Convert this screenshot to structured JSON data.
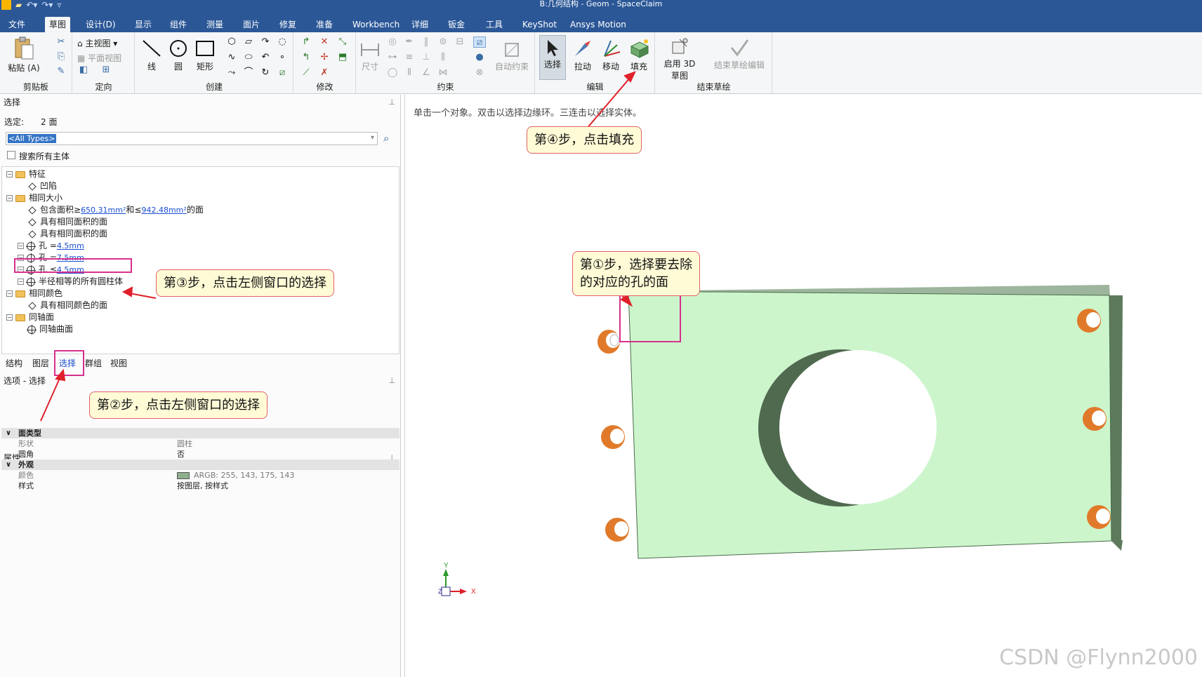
{
  "window": {
    "title": "B:几何结构 - Geom - SpaceClaim"
  },
  "menu_tabs": [
    "文件",
    "草图",
    "设计(D)",
    "显示",
    "组件",
    "测量",
    "面片",
    "修复",
    "准备",
    "Workbench",
    "详细",
    "钣金",
    "工具",
    "KeyShot",
    "Ansys Motion"
  ],
  "active_tab": "草图",
  "ribbon": {
    "clipboard": {
      "label": "剪贴板",
      "paste": "粘贴 (A)"
    },
    "orient": {
      "label": "定向",
      "main_view": "主视图",
      "plane_view": "平面视图"
    },
    "create": {
      "label": "创建",
      "line": "线",
      "circle": "圆",
      "rect": "矩形"
    },
    "modify": {
      "label": "修改"
    },
    "constraint": {
      "label": "约束",
      "dimension": "尺寸",
      "auto_constraint": "自动约束"
    },
    "edit": {
      "label": "编辑",
      "select": "选择",
      "pull": "拉动",
      "move": "移动",
      "fill": "填充"
    },
    "end_sketch": {
      "label": "结束草绘",
      "enable_3d": "启用 3D 草图",
      "end_edit": "结束草绘编辑"
    }
  },
  "select_panel": {
    "header": "选择",
    "selected_label": "选定:",
    "selected_value": "2 面",
    "type_filter": "<All Types>",
    "search_all_label": "搜索所有主体",
    "tree": [
      {
        "label": "特征",
        "kind": "folder"
      },
      {
        "label": "凹陷",
        "kind": "item"
      },
      {
        "label": "相同大小",
        "kind": "folder"
      },
      {
        "prefix": "包含面积≥ ",
        "link1": "650.31mm²",
        "mid": "和≤ ",
        "link2": "942.48mm²",
        "suffix": "的面"
      },
      {
        "label": "具有相同面积的面",
        "kind": "item"
      },
      {
        "label": "具有相同面积的面",
        "kind": "item"
      },
      {
        "prefix": "孔 = ",
        "link": "4.5mm"
      },
      {
        "prefix": "孔 = ",
        "link": "7.5mm"
      },
      {
        "prefix": "孔 ≤ ",
        "link": "4.5mm"
      },
      {
        "label": "半径相等的所有圆柱体",
        "kind": "hole"
      },
      {
        "label": "相同颜色",
        "kind": "folder"
      },
      {
        "label": "具有相同颜色的面",
        "kind": "item"
      },
      {
        "label": "同轴面",
        "kind": "folder"
      },
      {
        "label": "同轴曲面",
        "kind": "hole"
      }
    ]
  },
  "bottom_tabs": [
    "结构",
    "图层",
    "选择",
    "群组",
    "视图"
  ],
  "options_header": "选项 - 选择",
  "properties": {
    "header": "属性",
    "rows": [
      {
        "cat": "面类型"
      },
      {
        "k": "形状",
        "v": "圆柱"
      },
      {
        "k": "圆角",
        "v": "否"
      },
      {
        "cat": "外观"
      },
      {
        "k": "颜色",
        "v": "ARGB: 255, 143, 175, 143"
      },
      {
        "k": "样式",
        "v": "按图层, 按样式"
      }
    ]
  },
  "viewport": {
    "hint": "单击一个对象。双击以选择边缘环。三连击以选择实体。",
    "axis_x": "X",
    "axis_y": "Y",
    "axis_z": "Z"
  },
  "callouts": {
    "step4": "第④步，点击填充",
    "step1a": "第①步，选择要去除",
    "step1b": "的对应的孔的面",
    "step3": "第③步，点击左侧窗口的选择",
    "step2": "第②步，点击左侧窗口的选择"
  },
  "watermark": "CSDN @Flynn2000",
  "colors": {
    "titlebar": "#2b5797",
    "plate": "#ccf5cc",
    "hole_ring": "#e07a2a",
    "callout_bg": "#fffbd6",
    "highlight": "#d6308c"
  }
}
